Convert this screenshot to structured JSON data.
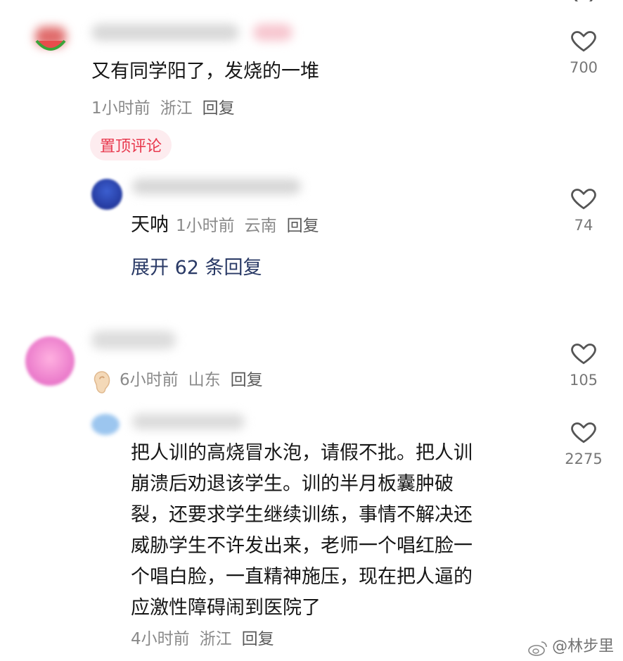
{
  "comments": [
    {
      "text": "又有同学阳了，发烧的一堆",
      "time": "1小时前",
      "location": "浙江",
      "reply_label": "回复",
      "likes": "700",
      "pinned_label": "置顶评论"
    },
    {
      "text": "天呐",
      "time": "1小时前",
      "location": "云南",
      "reply_label": "回复",
      "likes": "74"
    },
    {
      "time": "6小时前",
      "location": "山东",
      "reply_label": "回复",
      "likes": "105"
    },
    {
      "lines": [
        "把人训的高烧冒水泡，请假不批。把人训",
        "崩溃后劝退该学生。训的半月板囊肿破",
        "裂，还要求学生继续训练，事情不解决还",
        "威胁学生不许发出来，老师一个唱红脸一",
        "个唱白脸，一直精神施压，现在把人逼的",
        "应激性障碍闹到医院了"
      ],
      "time": "4小时前",
      "location": "浙江",
      "reply_label": "回复",
      "likes": "2275"
    }
  ],
  "expand_replies": "展开 62 条回复",
  "watermark": "@林步里",
  "icons": {
    "like": "heart-outline-icon",
    "badge": "ear-icon",
    "watermark": "weibo-logo-icon"
  }
}
